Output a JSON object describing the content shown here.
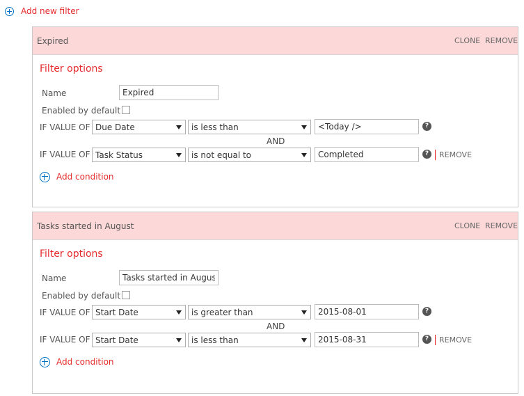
{
  "add_filter_label": "Add new filter",
  "filters": [
    {
      "title": "Expired",
      "clone_label": "CLONE",
      "remove_label": "REMOVE",
      "options_title": "Filter options",
      "name_label": "Name",
      "name_value": "Expired",
      "enabled_label": "Enabled by default",
      "enabled": false,
      "conditions": [
        {
          "if_label": "IF VALUE OF",
          "field": "Due Date",
          "operator": "is less than",
          "value": "<Today />"
        },
        {
          "if_label": "IF VALUE OF",
          "field": "Task Status",
          "operator": "is not equal to",
          "value": "Completed",
          "remove_label": "REMOVE"
        }
      ],
      "and_label": "AND",
      "add_condition_label": "Add condition"
    },
    {
      "title": "Tasks started in August",
      "clone_label": "CLONE",
      "remove_label": "REMOVE",
      "options_title": "Filter options",
      "name_label": "Name",
      "name_value": "Tasks started in August",
      "enabled_label": "Enabled by default",
      "enabled": false,
      "conditions": [
        {
          "if_label": "IF VALUE OF",
          "field": "Start Date",
          "operator": "is greater than",
          "value": "2015-08-01"
        },
        {
          "if_label": "IF VALUE OF",
          "field": "Start Date",
          "operator": "is less than",
          "value": "2015-08-31",
          "remove_label": "REMOVE"
        }
      ],
      "and_label": "AND",
      "add_condition_label": "Add condition"
    }
  ],
  "help_glyph": "?",
  "colors": {
    "accent_red": "#e52b2b",
    "header_bg": "#fdd8d8",
    "icon_blue": "#0072c6"
  }
}
